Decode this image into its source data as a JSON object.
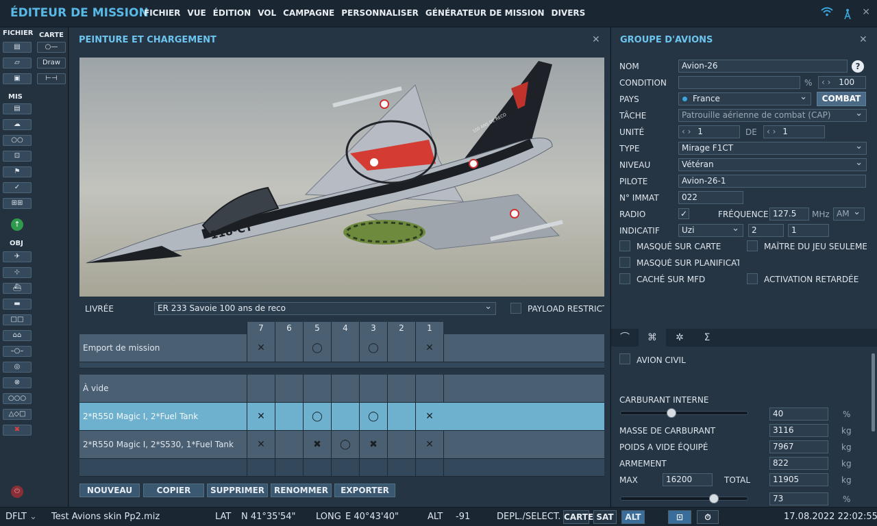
{
  "app": {
    "title": "ÉDITEUR DE MISSION"
  },
  "menu": [
    "FICHIER",
    "VUE",
    "ÉDITION",
    "VOL",
    "CAMPAGNE",
    "PERSONNALISER",
    "GÉNÉRATEUR DE MISSION",
    "DIVERS"
  ],
  "toolbar": {
    "fichier": "FICHIER",
    "carte": "CARTE",
    "mis": "MIS",
    "obj": "OBJ",
    "draw": "Draw"
  },
  "paint": {
    "title": "PEINTURE ET CHARGEMENT",
    "livery_label": "LIVRÉE",
    "livery_value": "ER 233 Savoie 100 ans de reco",
    "payload_label": "PAYLOAD RESTRICTIO",
    "columns": [
      "7",
      "6",
      "5",
      "4",
      "3",
      "2",
      "1"
    ],
    "rows": [
      {
        "name": "Emport de mission"
      },
      {
        "name": "À vide"
      },
      {
        "name": "2*R550 Magic I, 2*Fuel Tank"
      },
      {
        "name": "2*R550 Magic I, 2*S530, 1*Fuel Tank"
      }
    ],
    "buttons": {
      "new": "NOUVEAU",
      "copy": "COPIER",
      "delete": "SUPPRIMER",
      "rename": "RENOMMER",
      "export": "EXPORTER"
    },
    "aircraft_marking": "118-CT",
    "tail_text": "100 ANS DE RECO"
  },
  "group": {
    "title": "GROUPE D'AVIONS",
    "nom_label": "NOM",
    "nom_value": "Avion-26",
    "condition_label": "CONDITION",
    "condition_pct": "%",
    "condition_value": "100",
    "pays_label": "PAYS",
    "pays_value": "France",
    "combat": "COMBAT",
    "tache_label": "TÂCHE",
    "tache_value": "Patrouille aérienne de combat (CAP)",
    "unite_label": "UNITÉ",
    "unite_value": "1",
    "de_label": "DE",
    "de_value": "1",
    "type_label": "TYPE",
    "type_value": "Mirage F1CT",
    "niveau_label": "NIVEAU",
    "niveau_value": "Vétéran",
    "pilote_label": "PILOTE",
    "pilote_value": "Avion-26-1",
    "immat_label": "N° IMMAT",
    "immat_value": "022",
    "radio_label": "RADIO",
    "freq_label": "FRÉQUENCE",
    "freq_value": "127.5",
    "mhz": "MHz",
    "band": "AM",
    "indicatif_label": "INDICATIF",
    "indicatif_value": "Uzi",
    "ind_2": "2",
    "ind_3": "1",
    "masque_carte": "MASQUÉ SUR CARTE",
    "maitre": "MAÎTRE DU JEU SEULEMEN",
    "masque_planif": "MASQUÉ SUR PLANIFICATI",
    "cache_mfd": "CACHÉ SUR MFD",
    "activation": "ACTIVATION RETARDÉE",
    "civil": "AVION CIVIL",
    "fuel_label": "CARBURANT INTERNE",
    "fuel_value": "40",
    "fuel_unit": "%",
    "fuel_fraction": 0.4,
    "masse_label": "MASSE DE CARBURANT",
    "masse_value": "3116",
    "kg": "kg",
    "poids_label": "POIDS A VIDE ÉQUIPÉ",
    "poids_value": "7967",
    "arm_label": "ARMEMENT",
    "arm_value": "822",
    "max_label": "MAX",
    "max_value": "16200",
    "total_label": "TOTAL",
    "total_value": "11905",
    "last_value": "73",
    "last_fraction": 0.73
  },
  "status": {
    "profile": "DFLT",
    "file": "Test Avions skin Pp2.miz",
    "lat_label": "LAT",
    "lat_value": "N 41°35'54\"",
    "long_label": "LONG",
    "long_value": "E 40°43'40\"",
    "alt_label": "ALT",
    "alt_value": "-91",
    "mode": "DEPL./SELECT.",
    "carte": "CARTE",
    "sat": "SAT",
    "alt_btn": "ALT",
    "datetime": "17.08.2022 22:02:55"
  }
}
